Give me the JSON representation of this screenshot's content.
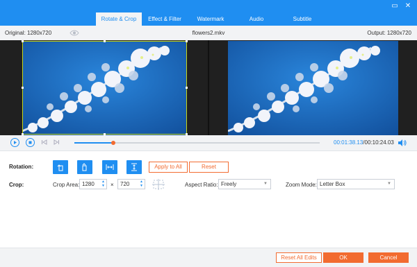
{
  "tabs": [
    {
      "label": "Rotate & Crop",
      "active": true
    },
    {
      "label": "Effect & Filter",
      "active": false
    },
    {
      "label": "Watermark",
      "active": false
    },
    {
      "label": "Audio",
      "active": false
    },
    {
      "label": "Subtitle",
      "active": false
    }
  ],
  "window": {
    "minimize": "▭",
    "close": "✕"
  },
  "info": {
    "original": "Original: 1280x720",
    "filename": "flowers2.mkv",
    "output": "Output: 1280x720"
  },
  "playback": {
    "current_time": "00:01:38.13",
    "separator": "/",
    "total_time": "00:10:24.03",
    "progress": 0.16
  },
  "rotation": {
    "label": "Rotation:",
    "apply_all": "Apply to All",
    "reset": "Reset"
  },
  "crop": {
    "label": "Crop:",
    "area_label": "Crop Area:",
    "width": "1280",
    "times": "×",
    "height": "720",
    "aspect_label": "Aspect Ratio:",
    "aspect_value": "Freely",
    "zoom_label": "Zoom Mode:",
    "zoom_value": "Letter Box"
  },
  "footer": {
    "reset_all": "Reset All Edits",
    "ok": "OK",
    "cancel": "Cancel"
  },
  "colors": {
    "accent": "#1f8ef1",
    "action": "#f26b30",
    "crop_frame": "#c6d61a"
  }
}
